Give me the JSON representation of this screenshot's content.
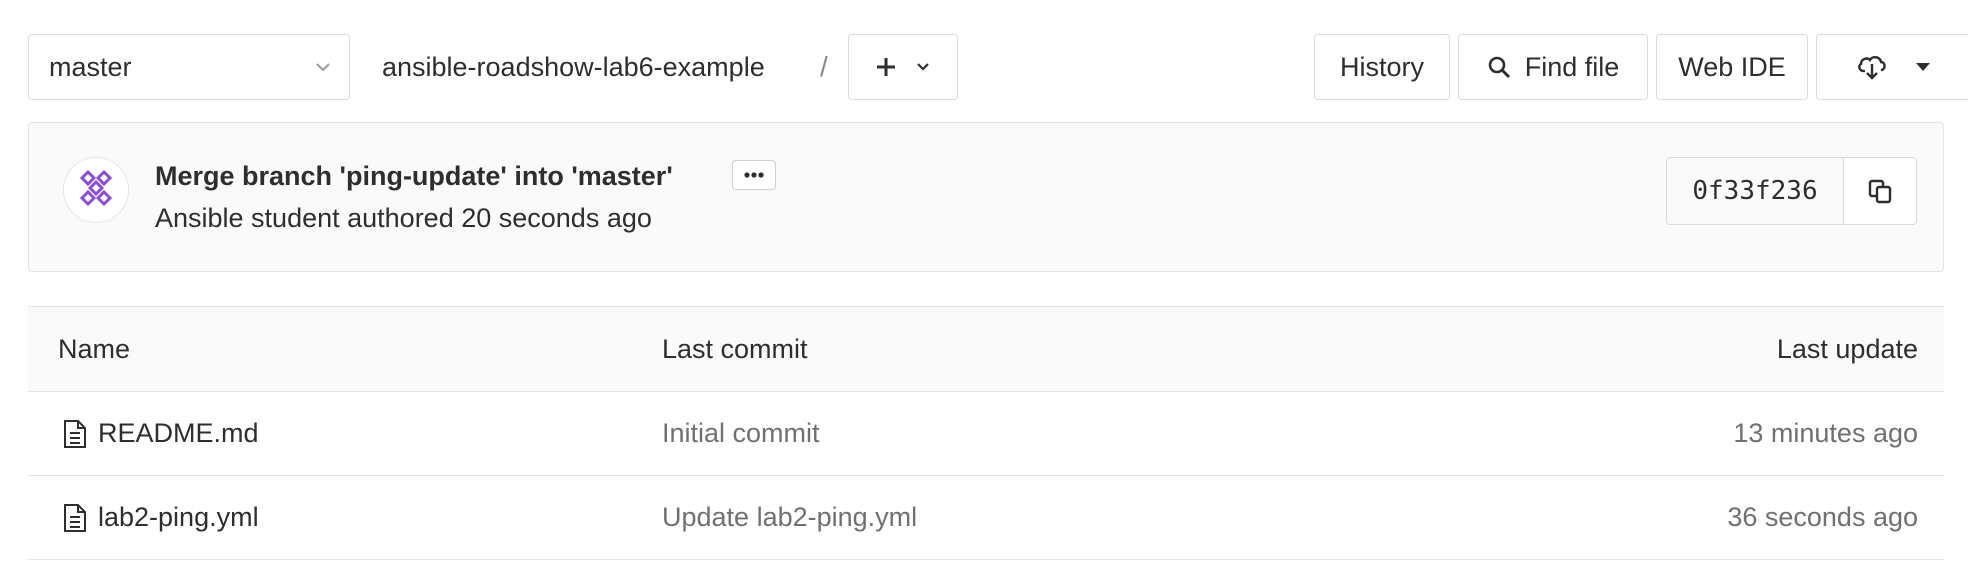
{
  "toolbar": {
    "branch": "master",
    "repo_name": "ansible-roadshow-lab6-example",
    "path_separator": "/",
    "history_label": "History",
    "find_file_label": "Find file",
    "web_ide_label": "Web IDE"
  },
  "commit": {
    "title": "Merge branch 'ping-update' into 'master'",
    "author": "Ansible student",
    "meta": "Ansible student authored 20 seconds ago",
    "sha": "0f33f236"
  },
  "table": {
    "headers": {
      "name": "Name",
      "last_commit": "Last commit",
      "last_update": "Last update"
    },
    "rows": [
      {
        "name": "README.md",
        "last_commit": "Initial commit",
        "last_update": "13 minutes ago"
      },
      {
        "name": "lab2-ping.yml",
        "last_commit": "Update lab2-ping.yml",
        "last_update": "36 seconds ago"
      }
    ]
  },
  "icons": {
    "branch_chevron": "chevron-down-icon",
    "add": "plus-icon",
    "add_chevron": "chevron-down-icon",
    "search": "search-icon",
    "download": "cloud-download-icon",
    "download_caret": "caret-down-icon",
    "ellipsis": "ellipsis-icon",
    "copy": "copy-icon",
    "file": "file-icon"
  },
  "colors": {
    "text": "#2e2e2e",
    "muted": "#707070",
    "border": "#dbdbdb",
    "panel_bg": "#fafafa",
    "avatar_accent": "#8a4fd6"
  }
}
